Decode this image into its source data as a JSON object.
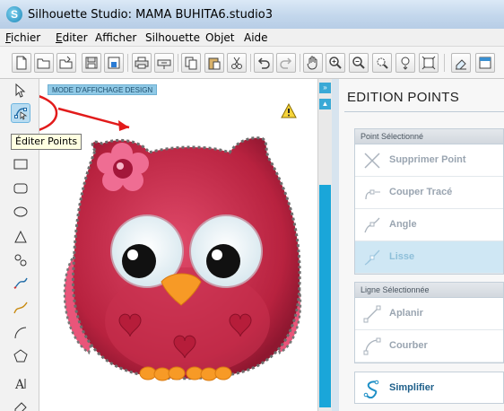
{
  "window": {
    "title": "Silhouette Studio: MAMA BUHITA6.studio3",
    "app_icon": "S"
  },
  "menu": {
    "items": [
      {
        "label": "Fichier",
        "accel": "F",
        "rest": "ichier"
      },
      {
        "label": "Editer",
        "accel": "E",
        "rest": "diter"
      },
      {
        "label": "Afficher"
      },
      {
        "label": "Silhouette"
      },
      {
        "label": "Objet"
      },
      {
        "label": "Aide"
      }
    ]
  },
  "toolbar": {
    "icons": [
      "new-document-icon",
      "open-folder-icon",
      "open-library-icon",
      "save-icon",
      "save-library-icon",
      "print-icon",
      "send-to-cutter-icon",
      "copy-icon",
      "paste-icon",
      "cut-icon",
      "undo-icon",
      "redo-icon",
      "pan-hand-icon",
      "zoom-in-icon",
      "zoom-out-icon",
      "zoom-select-icon",
      "zoom-drag-icon",
      "fit-to-page-icon",
      "eraser-icon",
      "panel-icon"
    ]
  },
  "canvas": {
    "mode_label": "MODE D'AFFICHAGE DESIGN",
    "tooltip": "Éditer Points",
    "warning_icon": "warning-icon",
    "accent_colors": {
      "owl_body": "#c8304f",
      "owl_light": "#e9557a",
      "eye_white": "#eef5f8",
      "beak": "#f79a26",
      "annotation_red": "#e21b1b"
    }
  },
  "left_tools": [
    "select-arrow-icon",
    "edit-points-icon",
    "rectangle-icon",
    "rounded-rectangle-icon",
    "ellipse-icon",
    "polygon-icon",
    "curve-icon",
    "freehand-icon",
    "smooth-freehand-icon",
    "arc-icon",
    "pentagon-icon",
    "text-icon",
    "eraser-tool-icon"
  ],
  "panel": {
    "title": "EDITION POINTS",
    "point_group": {
      "header": "Point Sélectionné",
      "actions": [
        {
          "label": "Supprimer Point",
          "icon": "delete-point-icon"
        },
        {
          "label": "Couper Tracé",
          "icon": "break-path-icon"
        },
        {
          "label": "Angle",
          "icon": "corner-point-icon"
        },
        {
          "label": "Lisse",
          "icon": "smooth-point-icon"
        }
      ]
    },
    "line_group": {
      "header": "Ligne Sélectionnée",
      "actions": [
        {
          "label": "Aplanir",
          "icon": "make-straight-icon"
        },
        {
          "label": "Courber",
          "icon": "make-curved-icon"
        }
      ]
    },
    "simplify": {
      "label": "Simplifier",
      "icon": "simplify-icon"
    }
  }
}
